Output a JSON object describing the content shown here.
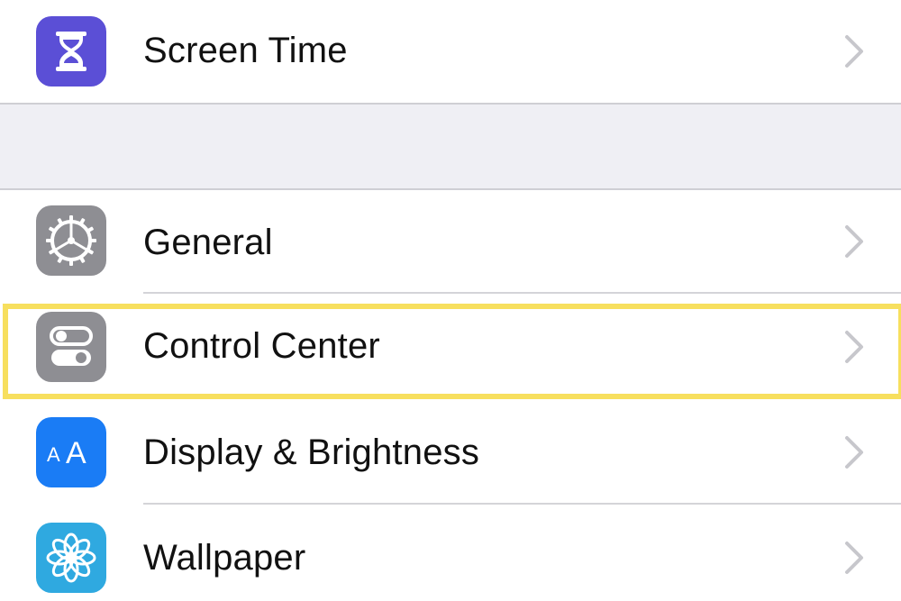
{
  "settings": {
    "rows": [
      {
        "label": "Screen Time",
        "icon": "hourglass-icon",
        "icon_color": "#5b4fd6"
      },
      {
        "label": "General",
        "icon": "gear-icon",
        "icon_color": "#8e8e93"
      },
      {
        "label": "Control Center",
        "icon": "toggles-icon",
        "icon_color": "#8e8e93"
      },
      {
        "label": "Display & Brightness",
        "icon": "text-size-icon",
        "icon_color": "#1a7cf5"
      },
      {
        "label": "Wallpaper",
        "icon": "flower-icon",
        "icon_color": "#2fa9e0"
      }
    ],
    "disclosure_glyph": "chevron-right-icon"
  },
  "highlight": {
    "target": "Control Center",
    "color": "#f7df5e"
  }
}
